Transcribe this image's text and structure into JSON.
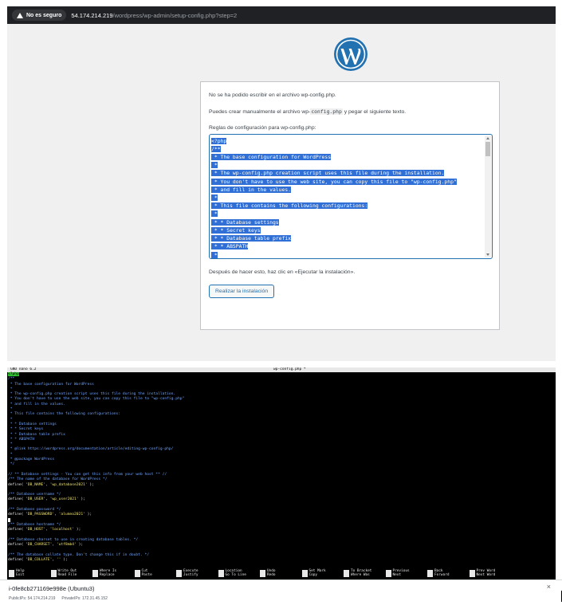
{
  "browser": {
    "security_label": "No es seguro",
    "url_host": "54.174.214.219",
    "url_path": "/wordpress/wp-admin/setup-config.php?step=2"
  },
  "wp": {
    "msg_cannot_write": "No se ha podido escribir en el archivo wp-config.php.",
    "msg_manual_pre": "Puedes crear manualmente el archivo wp-",
    "msg_manual_code": "config.php",
    "msg_manual_post": " y pegar el siguiente texto.",
    "config_label": "Reglas de configuración para wp-config.php:",
    "config_lines": [
      "<?php",
      "/**",
      " * The base configuration for WordPress",
      " *",
      " * The wp-config.php creation script uses this file during the installation.",
      " * You don't have to use the web site, you can copy this file to \"wp-config.php\"",
      " * and fill in the values.",
      " *",
      " * This file contains the following configurations:",
      " *",
      " * * Database settings",
      " * * Secret keys",
      " * * Database table prefix",
      " * * ABSPATH",
      " *"
    ],
    "after_text": "Después de hacer esto, haz clic en «Ejecutar la instalación».",
    "install_button": "Realizar la instalación"
  },
  "nano": {
    "version": "GNU nano 6.2",
    "filename": "wp-config.php *",
    "lines": [
      {
        "t": "<?php",
        "k": "php"
      },
      {
        "t": "/**",
        "k": "c"
      },
      {
        "t": " * The base configuration for WordPress",
        "k": "c"
      },
      {
        "t": " *",
        "k": "c"
      },
      {
        "t": " * The wp-config.php creation script uses this file during the installation.",
        "k": "c"
      },
      {
        "t": " * You don't have to use the web site, you can copy this file to \"wp-config.php\"",
        "k": "c"
      },
      {
        "t": " * and fill in the values.",
        "k": "c"
      },
      {
        "t": " *",
        "k": "c"
      },
      {
        "t": " * This file contains the following configurations:",
        "k": "c"
      },
      {
        "t": " *",
        "k": "c"
      },
      {
        "t": " * * Database settings",
        "k": "c"
      },
      {
        "t": " * * Secret keys",
        "k": "c"
      },
      {
        "t": " * * Database table prefix",
        "k": "c"
      },
      {
        "t": " * * ABSPATH",
        "k": "c"
      },
      {
        "t": " *",
        "k": "c"
      },
      {
        "t": " * @link https://wordpress.org/documentation/article/editing-wp-config-php/",
        "k": "c"
      },
      {
        "t": " *",
        "k": "c"
      },
      {
        "t": " * @package WordPress",
        "k": "c"
      },
      {
        "t": " */",
        "k": "c"
      },
      {
        "t": "",
        "k": "c"
      },
      {
        "t": "// ** Database settings - You can get this info from your web host ** //",
        "k": "c"
      },
      {
        "t": "/** The name of the database for WordPress */",
        "k": "c"
      },
      {
        "t": "define( 'DB_NAME', 'wp_database2021' );",
        "k": "code"
      },
      {
        "t": "",
        "k": "c"
      },
      {
        "t": "/** Database username */",
        "k": "c"
      },
      {
        "t": "define( 'DB_USER', 'wp_user2021' );",
        "k": "code"
      },
      {
        "t": "",
        "k": "c"
      },
      {
        "t": "/** Database password */",
        "k": "c"
      },
      {
        "t": "define( 'DB_PASSWORD', 'alumno2021' );",
        "k": "code"
      },
      {
        "t": "",
        "k": "cursor"
      },
      {
        "t": "/** Database hostname */",
        "k": "c"
      },
      {
        "t": "define( 'DB_HOST', 'localhost' );",
        "k": "code"
      },
      {
        "t": "",
        "k": "c"
      },
      {
        "t": "/** Database charset to use in creating database tables. */",
        "k": "c"
      },
      {
        "t": "define( 'DB_CHARSET', 'utf8mb4' );",
        "k": "code"
      },
      {
        "t": "",
        "k": "c"
      },
      {
        "t": "/** The database collate type. Don't change this if in doubt. */",
        "k": "c"
      },
      {
        "t": "define( 'DB_COLLATE', '' );",
        "k": "code"
      }
    ],
    "help": [
      {
        "top": "Help",
        "bottom": "Exit"
      },
      {
        "top": "Write Out",
        "bottom": "Read File"
      },
      {
        "top": "Where Is",
        "bottom": "Replace"
      },
      {
        "top": "Cut",
        "bottom": "Paste"
      },
      {
        "top": "Execute",
        "bottom": "Justify"
      },
      {
        "top": "Location",
        "bottom": "Go To Line"
      },
      {
        "top": "Undo",
        "bottom": "Redo"
      },
      {
        "top": "Set Mark",
        "bottom": "Copy"
      },
      {
        "top": "To Bracket",
        "bottom": "Where Was"
      },
      {
        "top": "Previous",
        "bottom": "Next"
      },
      {
        "top": "Back",
        "bottom": "Forward"
      },
      {
        "top": "Prev Word",
        "bottom": "Next Word"
      }
    ]
  },
  "ec2": {
    "instance": "i-0fe8cb271169e998e (Ubuntu3)",
    "public_ip": "PublicIPs: 54.174.214.219",
    "private_ip": "PrivateIPs: 172.31.45.152",
    "close": "×"
  }
}
